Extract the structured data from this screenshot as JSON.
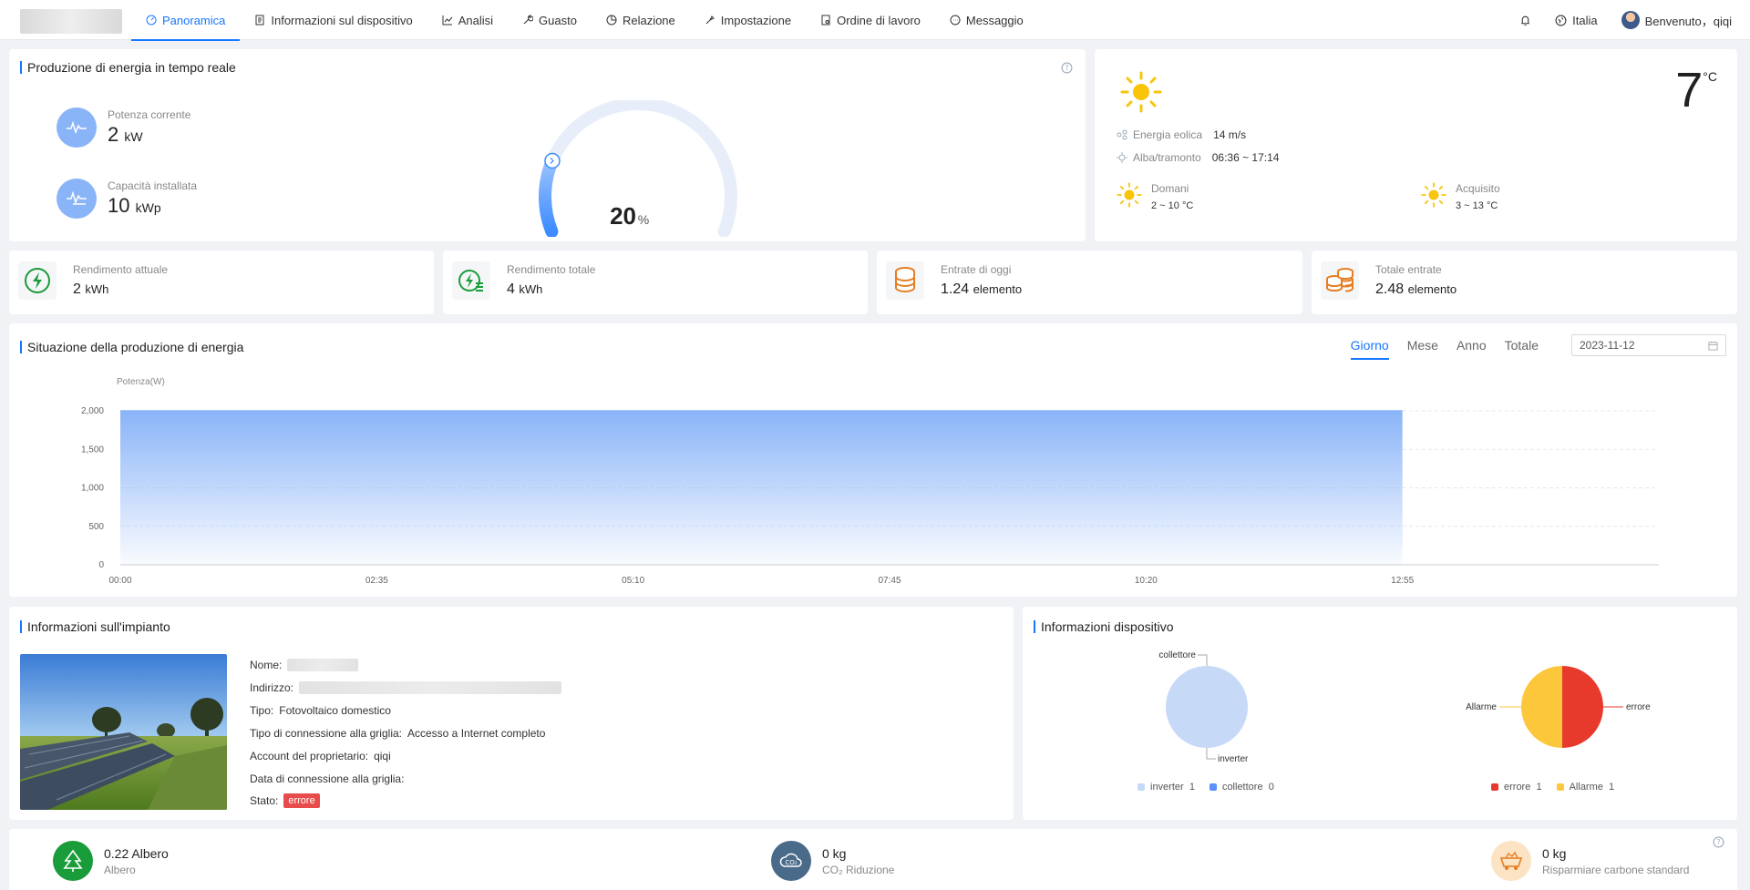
{
  "nav": {
    "items": [
      {
        "label": "Panoramica",
        "icon": "dashboard-icon",
        "active": true
      },
      {
        "label": "Informazioni sul dispositivo",
        "icon": "device-icon"
      },
      {
        "label": "Analisi",
        "icon": "chart-line-icon"
      },
      {
        "label": "Guasto",
        "icon": "wrench-icon"
      },
      {
        "label": "Relazione",
        "icon": "pie-icon"
      },
      {
        "label": "Impostazione",
        "icon": "tool-icon"
      },
      {
        "label": "Ordine di lavoro",
        "icon": "order-icon"
      },
      {
        "label": "Messaggio",
        "icon": "message-icon"
      }
    ],
    "language": "Italia",
    "welcome": "Benvenuto，qiqi"
  },
  "realtime": {
    "title": "Produzione di energia in tempo reale",
    "current_power_label": "Potenza corrente",
    "current_power_value": "2",
    "current_power_unit": "kW",
    "capacity_label": "Capacità installata",
    "capacity_value": "10",
    "capacity_unit": "kWp",
    "gauge_value": "20",
    "gauge_unit": "%",
    "gauge_fraction": 0.2
  },
  "weather": {
    "temperature": "7",
    "temp_unit": "°C",
    "wind_label": "Energia eolica",
    "wind_value": "14 m/s",
    "sun_label": "Alba/tramonto",
    "sun_value": "06:36 ~ 17:14",
    "tomorrow_label": "Domani",
    "tomorrow_value": "2 ~ 10 °C",
    "next_label": "Acquisito",
    "next_value": "3 ~ 13 °C"
  },
  "stats": [
    {
      "label": "Rendimento attuale",
      "value": "2",
      "unit": "kWh",
      "icon": "bolt-circle-icon"
    },
    {
      "label": "Rendimento totale",
      "value": "4",
      "unit": "kWh",
      "icon": "bolt-list-icon"
    },
    {
      "label": "Entrate di oggi",
      "value": "1.24",
      "unit": "elemento",
      "icon": "coin-stack-icon"
    },
    {
      "label": "Totale entrate",
      "value": "2.48",
      "unit": "elemento",
      "icon": "coins-icon"
    }
  ],
  "production": {
    "title": "Situazione della produzione di energia",
    "tabs": [
      "Giorno",
      "Mese",
      "Anno",
      "Totale"
    ],
    "active_tab": "Giorno",
    "date": "2023-11-12"
  },
  "chart_data": {
    "type": "area",
    "ylabel": "Potenza(W)",
    "y_ticks": [
      "2,000",
      "1,500",
      "1,000",
      "500",
      "0"
    ],
    "x_ticks": [
      "00:00",
      "02:35",
      "05:10",
      "07:45",
      "10:20",
      "12:55"
    ],
    "ylim": [
      0,
      2000
    ],
    "x_range_minutes": [
      0,
      930
    ],
    "series": [
      {
        "x_minutes": [
          0,
          775
        ],
        "values": [
          2000,
          2000
        ]
      }
    ],
    "color": "#8ab4f8"
  },
  "plant": {
    "title": "Informazioni sull'impianto",
    "name_label": "Nome:",
    "address_label": "Indirizzo:",
    "type_label": "Tipo:",
    "type_value": "Fotovoltaico domestico",
    "grid_type_label": "Tipo di connessione alla griglia:",
    "grid_type_value": "Accesso a Internet completo",
    "owner_label": "Account del proprietario:",
    "owner_value": "qiqi",
    "grid_date_label": "Data di connessione alla griglia:",
    "status_label": "Stato:",
    "status_value": "errore"
  },
  "devices": {
    "title": "Informazioni dispositivo",
    "pie1": {
      "labels": [
        "collettore",
        "inverter"
      ],
      "legend": [
        {
          "name": "inverter",
          "count": "1",
          "color": "#c6d9f7"
        },
        {
          "name": "collettore",
          "count": "0",
          "color": "#5b8ff9"
        }
      ]
    },
    "pie2": {
      "labels": [
        "Allarme",
        "errore"
      ],
      "legend": [
        {
          "name": "errore",
          "count": "1",
          "color": "#e8392d"
        },
        {
          "name": "Allarme",
          "count": "1",
          "color": "#fcc73a"
        }
      ]
    }
  },
  "eco": [
    {
      "value": "0.22 Albero",
      "label": "Albero",
      "icon": "tree-icon",
      "color": "#1a9c3a"
    },
    {
      "value": "0 kg",
      "label": "CO₂ Riduzione",
      "icon": "co2-cloud-icon",
      "color": "#4a6a8a"
    },
    {
      "value": "0 kg",
      "label": "Risparmiare carbone standard",
      "icon": "coal-cart-icon",
      "color": "#fbe3c4"
    }
  ]
}
